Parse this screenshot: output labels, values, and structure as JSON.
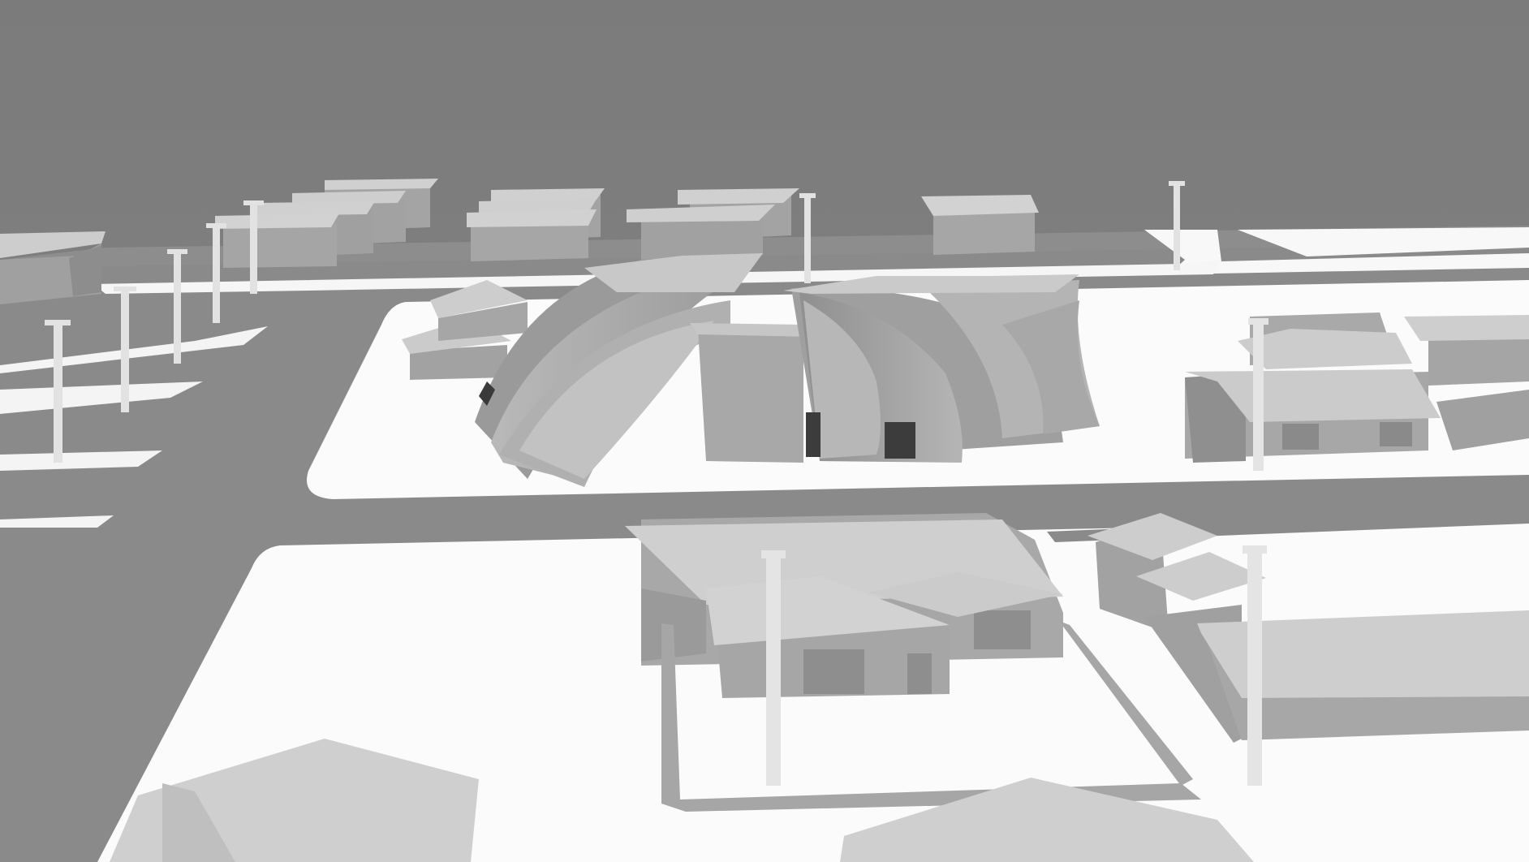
{
  "scene": {
    "kind": "grayscale 3D massing render",
    "colors": {
      "sky": "#7f7f7f",
      "road": "#8a8a8a",
      "ground": "#fbfbfb",
      "roof": "#cfcfcf",
      "wall": "#a7a7a7",
      "wall_dark": "#8f8f8f",
      "shell_light": "#c4c4c4",
      "shell_mid": "#a9a9a9",
      "shell_dark": "#8c8c8c",
      "pole": "#e3e3e3"
    }
  }
}
